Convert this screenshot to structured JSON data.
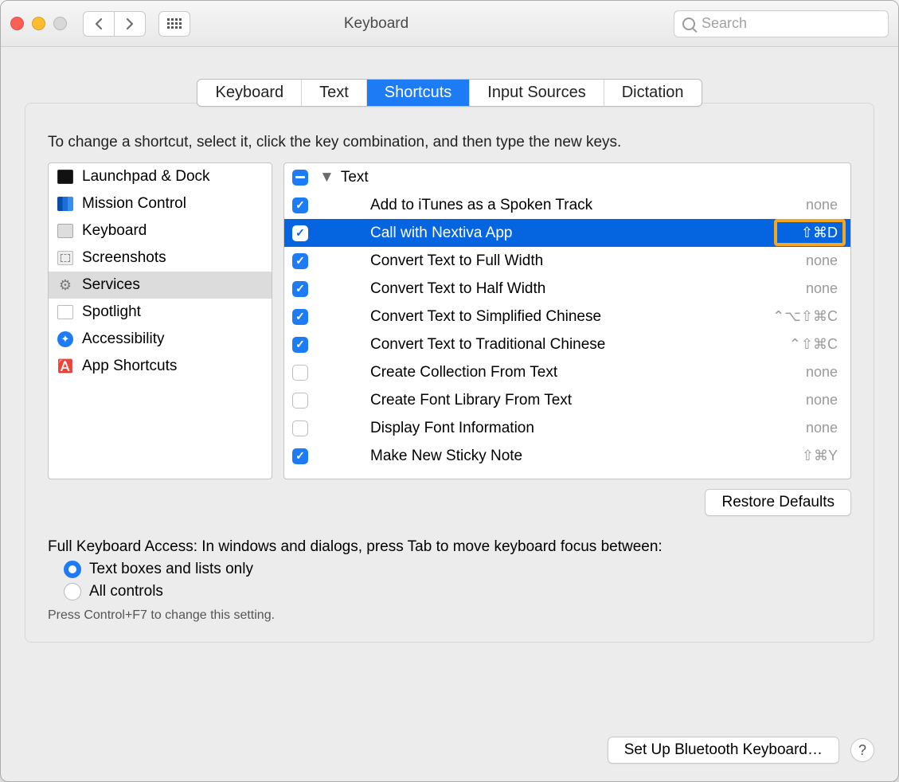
{
  "window": {
    "title": "Keyboard"
  },
  "search": {
    "placeholder": "Search"
  },
  "tabs": [
    {
      "label": "Keyboard",
      "active": false
    },
    {
      "label": "Text",
      "active": false
    },
    {
      "label": "Shortcuts",
      "active": true
    },
    {
      "label": "Input Sources",
      "active": false
    },
    {
      "label": "Dictation",
      "active": false
    }
  ],
  "instructions": "To change a shortcut, select it, click the key combination, and then type the new keys.",
  "sidebar": {
    "items": [
      {
        "label": "Launchpad & Dock",
        "icon": "launchpad"
      },
      {
        "label": "Mission Control",
        "icon": "mission"
      },
      {
        "label": "Keyboard",
        "icon": "keyboard"
      },
      {
        "label": "Screenshots",
        "icon": "screenshots"
      },
      {
        "label": "Services",
        "icon": "services",
        "selected": true
      },
      {
        "label": "Spotlight",
        "icon": "spotlight"
      },
      {
        "label": "Accessibility",
        "icon": "accessibility"
      },
      {
        "label": "App Shortcuts",
        "icon": "appshortcuts"
      }
    ]
  },
  "shortcuts": {
    "group_label": "Text",
    "group_state": "indeterminate",
    "items": [
      {
        "checked": true,
        "label": "Add to iTunes as a Spoken Track",
        "shortcut": "none",
        "selected": false
      },
      {
        "checked": true,
        "label": "Call with Nextiva App",
        "shortcut": "⇧⌘D",
        "selected": true,
        "highlight": true
      },
      {
        "checked": true,
        "label": "Convert Text to Full Width",
        "shortcut": "none"
      },
      {
        "checked": true,
        "label": "Convert Text to Half Width",
        "shortcut": "none"
      },
      {
        "checked": true,
        "label": "Convert Text to Simplified Chinese",
        "shortcut": "⌃⌥⇧⌘C"
      },
      {
        "checked": true,
        "label": "Convert Text to Traditional Chinese",
        "shortcut": "⌃⇧⌘C"
      },
      {
        "checked": false,
        "label": "Create Collection From Text",
        "shortcut": "none"
      },
      {
        "checked": false,
        "label": "Create Font Library From Text",
        "shortcut": "none"
      },
      {
        "checked": false,
        "label": "Display Font Information",
        "shortcut": "none"
      },
      {
        "checked": true,
        "label": "Make New Sticky Note",
        "shortcut": "⇧⌘Y"
      }
    ]
  },
  "restore_button": "Restore Defaults",
  "full_keyboard_access": {
    "heading": "Full Keyboard Access: In windows and dialogs, press Tab to move keyboard focus between:",
    "options": [
      {
        "label": "Text boxes and lists only",
        "selected": true
      },
      {
        "label": "All controls",
        "selected": false
      }
    ],
    "hint": "Press Control+F7 to change this setting."
  },
  "footer": {
    "bluetooth_button": "Set Up Bluetooth Keyboard…"
  }
}
